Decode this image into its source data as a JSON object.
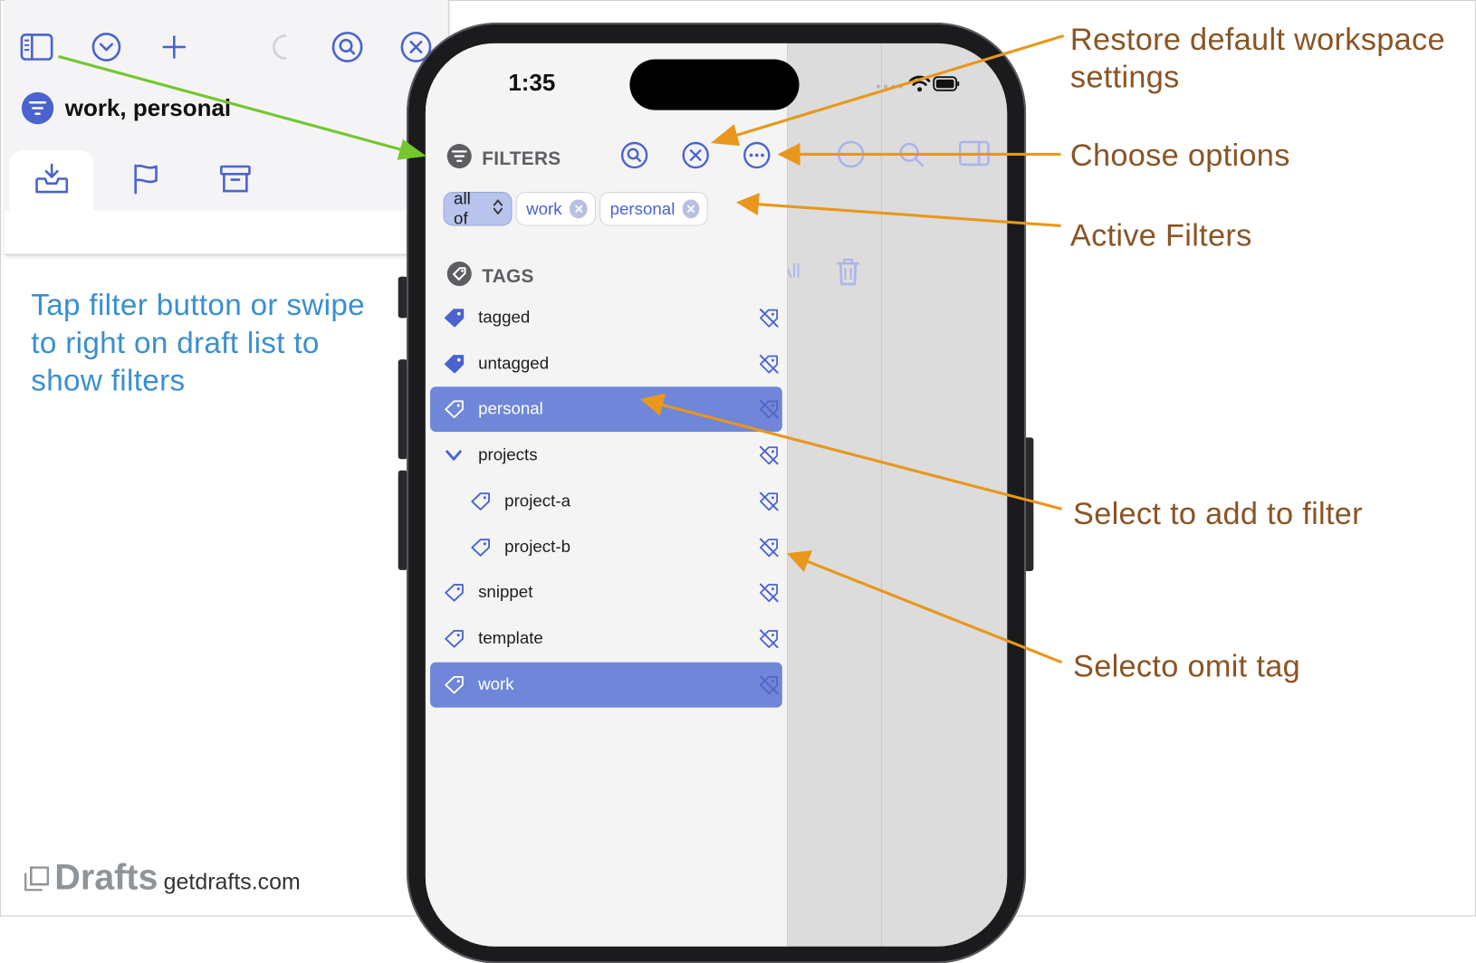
{
  "inset": {
    "title": "work, personal",
    "toolbar": [
      "sidebar-icon",
      "chevron-down-circle-icon",
      "plus-icon",
      "loading-spinner-icon",
      "search-circle-icon",
      "close-circle-icon"
    ],
    "tabs": [
      "inbox-icon",
      "flag-icon",
      "archive-icon"
    ]
  },
  "instruction": "Tap filter button or swipe to right on draft list to show filters",
  "brand": {
    "name": "Drafts",
    "url": "getdrafts.com"
  },
  "phone": {
    "status_time": "1:35",
    "filters": {
      "header": "FILTERS",
      "mode_label": "all of",
      "active_filters": [
        "work",
        "personal"
      ]
    },
    "tags_header": "TAGS",
    "tags": [
      {
        "label": "tagged",
        "selected": false,
        "indent": 0,
        "kind": "filled"
      },
      {
        "label": "untagged",
        "selected": false,
        "indent": 0,
        "kind": "filled"
      },
      {
        "label": "personal",
        "selected": true,
        "indent": 0,
        "kind": "outline"
      },
      {
        "label": "projects",
        "selected": false,
        "indent": 0,
        "kind": "chevron"
      },
      {
        "label": "project-a",
        "selected": false,
        "indent": 1,
        "kind": "outline"
      },
      {
        "label": "project-b",
        "selected": false,
        "indent": 1,
        "kind": "outline"
      },
      {
        "label": "snippet",
        "selected": false,
        "indent": 0,
        "kind": "outline"
      },
      {
        "label": "template",
        "selected": false,
        "indent": 0,
        "kind": "outline"
      },
      {
        "label": "work",
        "selected": true,
        "indent": 0,
        "kind": "outline"
      }
    ],
    "behind_text": "All"
  },
  "annotations": {
    "restore": "Restore default workspace settings",
    "options": "Choose options",
    "active": "Active Filters",
    "select_add": "Select to add to filter",
    "select_omit": "Selecto omit tag"
  },
  "colors": {
    "accent": "#4a63cf",
    "selected_row": "#6f86d9",
    "annotation_arrow": "#e8971c",
    "annotation_text": "#8a5424",
    "instruction_text": "#3a8fd0",
    "green_arrow": "#73c72d"
  }
}
